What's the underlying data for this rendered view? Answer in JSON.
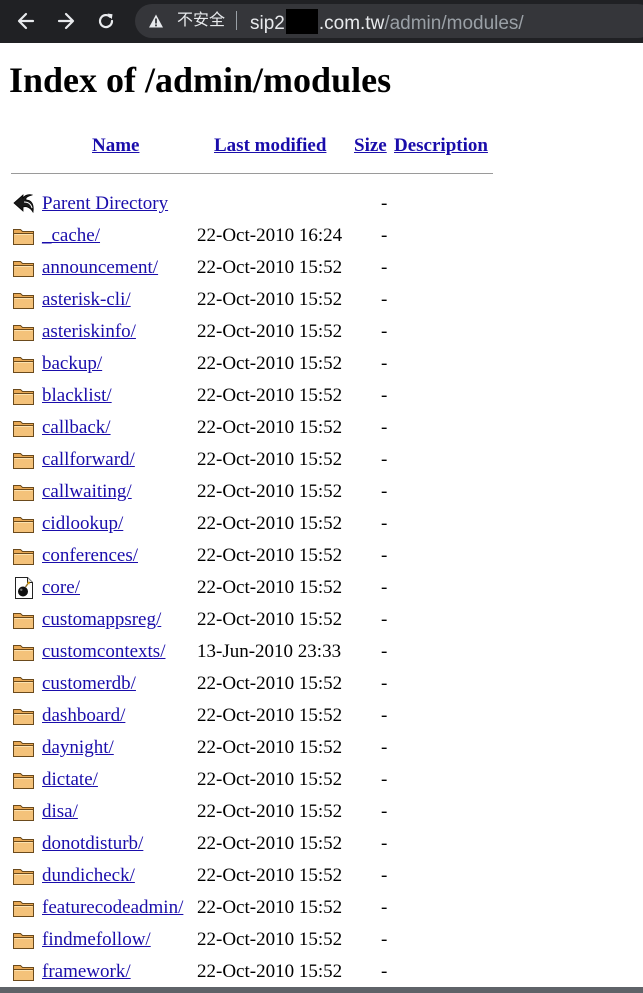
{
  "browser": {
    "insecure_label": "不安全",
    "url_host_prefix": "sip2",
    "url_host_suffix": ".com.tw",
    "url_path": "/admin/modules/"
  },
  "page": {
    "title": "Index of /admin/modules",
    "columns": {
      "name": "Name",
      "modified": "Last modified",
      "size": "Size",
      "description": "Description"
    }
  },
  "parent": {
    "name": "Parent Directory",
    "size": "-",
    "icon": "back-arrow-icon"
  },
  "entries": [
    {
      "name": "_cache/",
      "modified": "22-Oct-2010 16:24",
      "size": "-",
      "icon": "folder-icon"
    },
    {
      "name": "announcement/",
      "modified": "22-Oct-2010 15:52",
      "size": "-",
      "icon": "folder-icon"
    },
    {
      "name": "asterisk-cli/",
      "modified": "22-Oct-2010 15:52",
      "size": "-",
      "icon": "folder-icon"
    },
    {
      "name": "asteriskinfo/",
      "modified": "22-Oct-2010 15:52",
      "size": "-",
      "icon": "folder-icon"
    },
    {
      "name": "backup/",
      "modified": "22-Oct-2010 15:52",
      "size": "-",
      "icon": "folder-icon"
    },
    {
      "name": "blacklist/",
      "modified": "22-Oct-2010 15:52",
      "size": "-",
      "icon": "folder-icon"
    },
    {
      "name": "callback/",
      "modified": "22-Oct-2010 15:52",
      "size": "-",
      "icon": "folder-icon"
    },
    {
      "name": "callforward/",
      "modified": "22-Oct-2010 15:52",
      "size": "-",
      "icon": "folder-icon"
    },
    {
      "name": "callwaiting/",
      "modified": "22-Oct-2010 15:52",
      "size": "-",
      "icon": "folder-icon"
    },
    {
      "name": "cidlookup/",
      "modified": "22-Oct-2010 15:52",
      "size": "-",
      "icon": "folder-icon"
    },
    {
      "name": "conferences/",
      "modified": "22-Oct-2010 15:52",
      "size": "-",
      "icon": "folder-icon"
    },
    {
      "name": "core/",
      "modified": "22-Oct-2010 15:52",
      "size": "-",
      "icon": "core-dump-icon"
    },
    {
      "name": "customappsreg/",
      "modified": "22-Oct-2010 15:52",
      "size": "-",
      "icon": "folder-icon"
    },
    {
      "name": "customcontexts/",
      "modified": "13-Jun-2010 23:33",
      "size": "-",
      "icon": "folder-icon"
    },
    {
      "name": "customerdb/",
      "modified": "22-Oct-2010 15:52",
      "size": "-",
      "icon": "folder-icon"
    },
    {
      "name": "dashboard/",
      "modified": "22-Oct-2010 15:52",
      "size": "-",
      "icon": "folder-icon"
    },
    {
      "name": "daynight/",
      "modified": "22-Oct-2010 15:52",
      "size": "-",
      "icon": "folder-icon"
    },
    {
      "name": "dictate/",
      "modified": "22-Oct-2010 15:52",
      "size": "-",
      "icon": "folder-icon"
    },
    {
      "name": "disa/",
      "modified": "22-Oct-2010 15:52",
      "size": "-",
      "icon": "folder-icon"
    },
    {
      "name": "donotdisturb/",
      "modified": "22-Oct-2010 15:52",
      "size": "-",
      "icon": "folder-icon"
    },
    {
      "name": "dundicheck/",
      "modified": "22-Oct-2010 15:52",
      "size": "-",
      "icon": "folder-icon"
    },
    {
      "name": "featurecodeadmin/",
      "modified": "22-Oct-2010 15:52",
      "size": "-",
      "icon": "folder-icon"
    },
    {
      "name": "findmefollow/",
      "modified": "22-Oct-2010 15:52",
      "size": "-",
      "icon": "folder-icon"
    },
    {
      "name": "framework/",
      "modified": "22-Oct-2010 15:52",
      "size": "-",
      "icon": "folder-icon"
    }
  ],
  "colors": {
    "chrome_bg": "#202124",
    "omnibox_bg": "#35363a",
    "link": "#1a0dab",
    "folder": "#f4c27a"
  }
}
